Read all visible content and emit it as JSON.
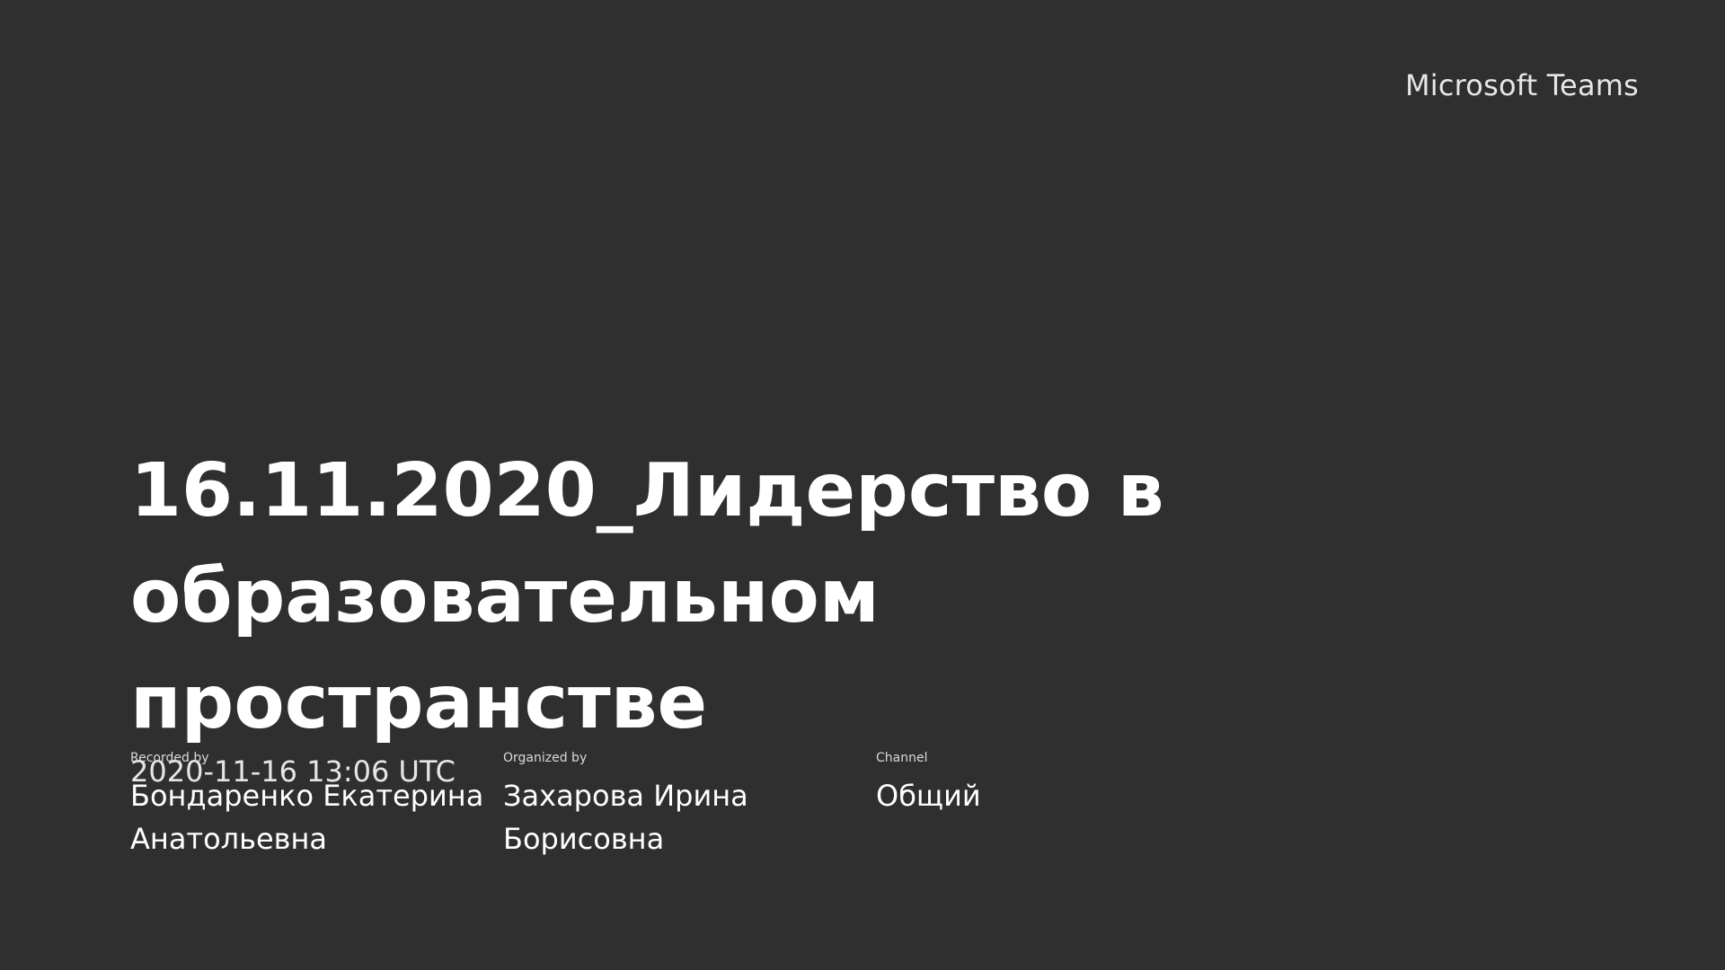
{
  "brand": {
    "name": "Microsoft Teams"
  },
  "recording": {
    "title": "16.11.2020_Лидерство в образовательном пространстве",
    "datetime": "2020-11-16 13:06 UTC"
  },
  "meta": {
    "recorded_by": {
      "label": "Recorded by",
      "value": "Бондаренко Екатерина Анатольевна"
    },
    "organized_by": {
      "label": "Organized by",
      "value": "Захарова Ирина Борисовна"
    },
    "channel": {
      "label": "Channel",
      "value": "Общий"
    }
  }
}
